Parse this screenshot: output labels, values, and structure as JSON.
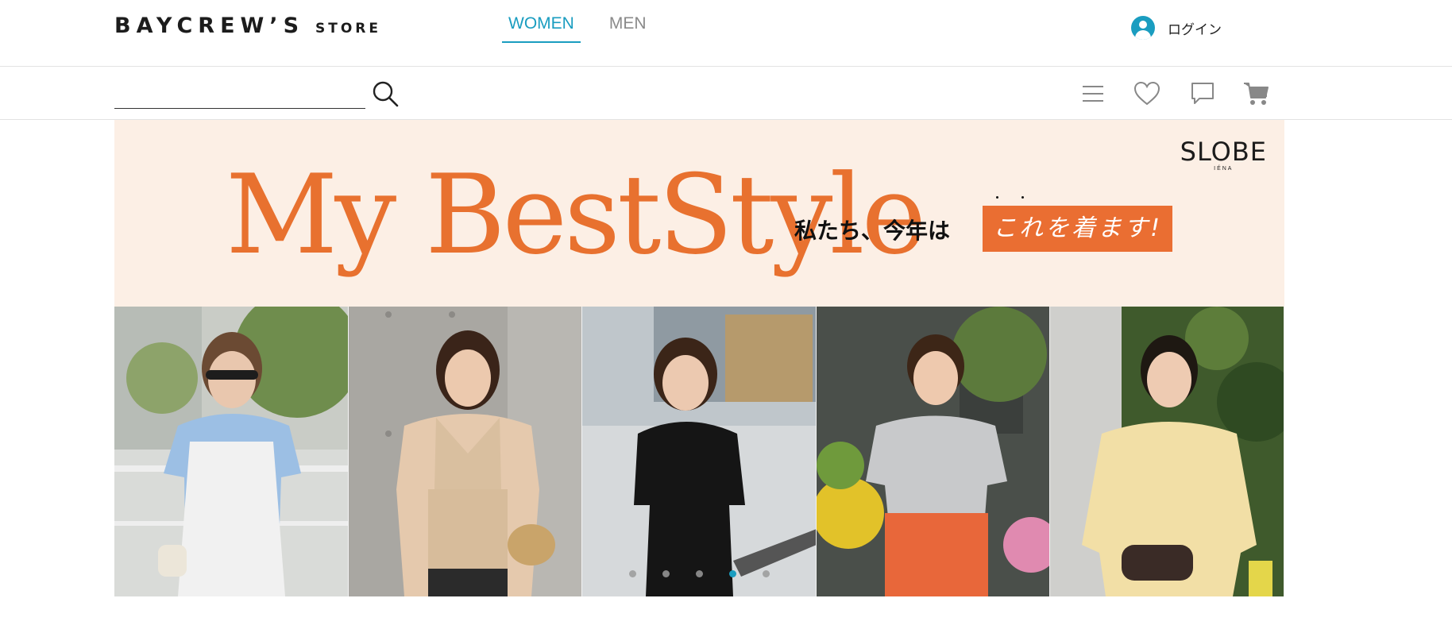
{
  "header": {
    "logo_main": "BAYCREW’S",
    "logo_sub": "STORE",
    "tabs": [
      {
        "label": "WOMEN",
        "active": true
      },
      {
        "label": "MEN",
        "active": false
      }
    ],
    "login_label": "ログイン",
    "accent_color": "#1a9dc0"
  },
  "toolbar": {
    "search_value": "",
    "search_icon": "search-icon",
    "icons": [
      "menu-icon",
      "heart-icon",
      "chat-icon",
      "cart-icon"
    ]
  },
  "banner": {
    "brand_main": "SLOBE",
    "brand_sub": "IÉNA",
    "headline": "My BestStyle",
    "tagline": "私たち、今年は",
    "tag_box": "これを着ます!",
    "accent_color": "#ea6e32",
    "background_color": "#fcefe5",
    "photo_count": 5,
    "carousel": {
      "slides": 5,
      "active_index": 3
    }
  }
}
